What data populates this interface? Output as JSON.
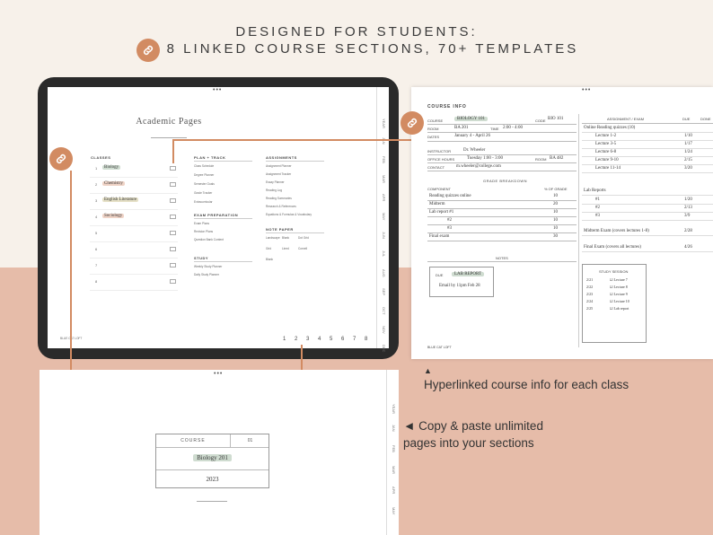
{
  "header": {
    "line1": "DESIGNED FOR STUDENTS:",
    "line2": "8 LINKED COURSE SECTIONS, 70+ TEMPLATES"
  },
  "icons": [
    "link-icon"
  ],
  "colors": {
    "accent": "#d28b62",
    "bg_top": "#f7f1ea",
    "bg_bottom": "#e6bca9"
  },
  "tablet": {
    "page_title": "Academic Pages",
    "classes_heading": "CLASSES",
    "classes": [
      {
        "num": "1",
        "label": "Biology",
        "color": "#cfdcd0"
      },
      {
        "num": "2",
        "label": "Chemistry",
        "color": "#efd3c6"
      },
      {
        "num": "3",
        "label": "English Literature",
        "color": "#e5e0c6"
      },
      {
        "num": "4",
        "label": "Sociology",
        "color": "#efd3c6"
      },
      {
        "num": "5",
        "label": "",
        "color": ""
      },
      {
        "num": "6",
        "label": "",
        "color": ""
      },
      {
        "num": "7",
        "label": "",
        "color": ""
      },
      {
        "num": "8",
        "label": "",
        "color": ""
      }
    ],
    "plan_track": {
      "heading": "PLAN + TRACK",
      "items": [
        "Class Schedule",
        "Degree Planner",
        "Semester Goals",
        "Grade Tracker",
        "Extracurricular"
      ]
    },
    "exam_prep": {
      "heading": "EXAM PREPARATION",
      "items": [
        "Exam Plans",
        "Revision Plans",
        "Question Bank Content"
      ]
    },
    "study": {
      "heading": "STUDY",
      "items": [
        "Weekly Study Planner",
        "Daily Study Planner"
      ]
    },
    "assignments": {
      "heading": "ASSIGNMENTS",
      "items": [
        "Assignment Planner",
        "Assignment Tracker",
        "Essay Planner",
        "Reading Log",
        "Reading Summaries",
        "Research & References",
        "Equations & Formulas & Vocabulary"
      ]
    },
    "note_paper": {
      "heading": "NOTE PAPER",
      "items": [
        "Landscape",
        "Blank",
        "Dot Grid",
        "Grid",
        "Lined",
        "Cornell",
        "Blank"
      ]
    },
    "tabs": [
      "YEAR",
      "JAN",
      "FEB",
      "MAR",
      "APR",
      "MAY",
      "JUN",
      "JUL",
      "AUG",
      "SEP",
      "OCT",
      "NOV",
      "DEC"
    ],
    "brand": "BLUE CAT LOFT",
    "page_numbers": "1 2 3 4 5 6 7 8"
  },
  "course_info": {
    "title": "COURSE INFO",
    "course_label": "COURSE",
    "course_value": "BIOLOGY 101",
    "code_label": "CODE",
    "code_value": "BIO 101",
    "room_label": "ROOM",
    "room_value": "BA 201",
    "time_label": "TIME",
    "time_value": "2:00 - 4:00",
    "dates_label": "DATES",
    "dates_value": "January 4 - April 26",
    "instructor_label": "INSTRUCTOR",
    "instructor_value": "Dr. Wheeler",
    "office_label": "OFFICE HOURS",
    "office_value": "Tuesday 1:00 - 3:00",
    "office_room_label": "ROOM",
    "office_room_value": "BA 482",
    "contact_label": "CONTACT",
    "contact_value": "m.wheeler@college.com",
    "grade_heading": "GRADE BREAKDOWN",
    "component_label": "COMPONENT",
    "pct_label": "% OF GRADE",
    "grades": [
      {
        "c": "Reading quizzes online",
        "p": "10"
      },
      {
        "c": "Midterm",
        "p": "20"
      },
      {
        "c": "Lab report #1",
        "p": "10"
      },
      {
        "c": "#2",
        "p": "10"
      },
      {
        "c": "#3",
        "p": "10"
      },
      {
        "c": "Final exam",
        "p": "30"
      }
    ],
    "notes_heading": "NOTES",
    "note_due": "DUE",
    "note_title": "LAB REPORT",
    "note_sub": "Email by 11pm Feb 28",
    "assign_header": "ASSIGNMENT / EXAM",
    "due_header": "DUE",
    "done_header": "DONE",
    "assignments": [
      {
        "a": "Online Reading quizzes (10)",
        "d": ""
      },
      {
        "a": "Lecture 1-2",
        "d": "1/10"
      },
      {
        "a": "Lecture 3-5",
        "d": "1/17"
      },
      {
        "a": "Lecture 6-8",
        "d": "1/24"
      },
      {
        "a": "Lecture 9-10",
        "d": "2/15"
      },
      {
        "a": "Lecture 11-14",
        "d": "3/20"
      },
      {
        "a": "Lab Reports",
        "d": ""
      },
      {
        "a": "#1",
        "d": "1/20"
      },
      {
        "a": "#2",
        "d": "2/13"
      },
      {
        "a": "#3",
        "d": "3/9"
      },
      {
        "a": "Midterm Exam (covers lectures 1-8)",
        "d": "2/28"
      },
      {
        "a": "Final Exam (covers all lectures)",
        "d": "4/26"
      }
    ],
    "study_session_heading": "STUDY SESSION",
    "study_sessions": [
      {
        "t": "2/21",
        "v": "Lecture 7"
      },
      {
        "t": "2/22",
        "v": "Lecture 8"
      },
      {
        "t": "2/23",
        "v": "Lecture 9"
      },
      {
        "t": "2/24",
        "v": "Lecture 10"
      },
      {
        "t": "2/25",
        "v": "Lab report"
      }
    ],
    "brand": "BLUE CAT LOFT"
  },
  "captions": {
    "course_info": "Hyperlinked course info for each class",
    "copy_paste_1": "Copy & paste unlimited",
    "copy_paste_2": "pages into your sections"
  },
  "bottom_page": {
    "course_label": "COURSE",
    "course_num": "01",
    "course_value": "Biology 201",
    "year": "2023",
    "tabs": [
      "YEAR",
      "JAN",
      "FEB",
      "MAR",
      "APR",
      "MAY"
    ]
  }
}
